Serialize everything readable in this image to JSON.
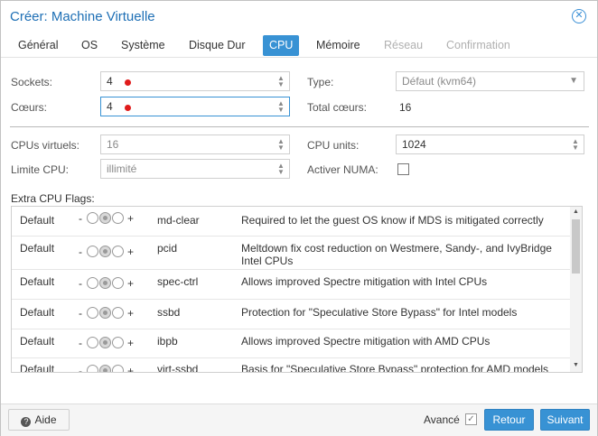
{
  "window": {
    "title": "Créer: Machine Virtuelle"
  },
  "tabs": [
    "Général",
    "OS",
    "Système",
    "Disque Dur",
    "CPU",
    "Mémoire",
    "Réseau",
    "Confirmation"
  ],
  "form": {
    "sockets_label": "Sockets:",
    "sockets_value": "4",
    "cores_label": "Cœurs:",
    "cores_value": "4",
    "type_label": "Type:",
    "type_value": "Défaut (kvm64)",
    "total_label": "Total cœurs:",
    "total_value": "16",
    "vcpus_label": "CPUs virtuels:",
    "vcpus_value": "16",
    "cpuunits_label": "CPU units:",
    "cpuunits_value": "1024",
    "limit_label": "Limite CPU:",
    "limit_value": "illimité",
    "numa_label": "Activer NUMA:"
  },
  "flags_title": "Extra CPU Flags:",
  "flags": [
    {
      "state": "Default",
      "name": "md-clear",
      "desc": "Required to let the guest OS know if MDS is mitigated correctly"
    },
    {
      "state": "Default",
      "name": "pcid",
      "desc": "Meltdown fix cost reduction on Westmere, Sandy-, and IvyBridge Intel CPUs"
    },
    {
      "state": "Default",
      "name": "spec-ctrl",
      "desc": "Allows improved Spectre mitigation with Intel CPUs"
    },
    {
      "state": "Default",
      "name": "ssbd",
      "desc": "Protection for \"Speculative Store Bypass\" for Intel models"
    },
    {
      "state": "Default",
      "name": "ibpb",
      "desc": "Allows improved Spectre mitigation with AMD CPUs"
    },
    {
      "state": "Default",
      "name": "virt-ssbd",
      "desc": "Basis for \"Speculative Store Bypass\" protection for AMD models"
    }
  ],
  "footer": {
    "help": "Aide",
    "advanced": "Avancé",
    "back": "Retour",
    "next": "Suivant"
  },
  "colors": {
    "accent": "#3892d4",
    "title": "#1e6fb5",
    "marker": "#e01b1b"
  }
}
